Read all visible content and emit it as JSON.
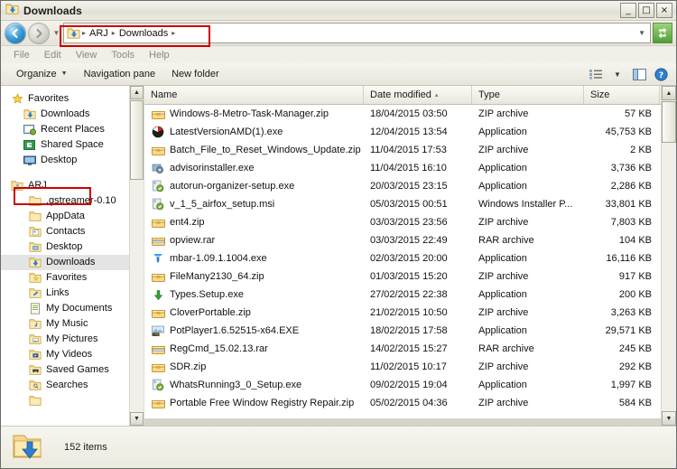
{
  "window": {
    "title": "Downloads",
    "title_icon": "folder-download-icon",
    "controls": {
      "minimize": "_",
      "maximize": "□",
      "close": "×"
    }
  },
  "address_bar": {
    "back_label": "Back",
    "forward_label": "Forward",
    "history_dropdown": "recent-locations-dropdown",
    "folder_icon": "folder-download-icon",
    "crumbs": [
      "ARJ",
      "Downloads"
    ],
    "separator": "▸",
    "dropdown_caret": "▼",
    "refresh_label": "Refresh",
    "highlighted": true
  },
  "menu": {
    "items": [
      "File",
      "Edit",
      "View",
      "Tools",
      "Help"
    ]
  },
  "toolbar": {
    "organize_label": "Organize",
    "organize_caret": "▼",
    "navigation_pane_label": "Navigation pane",
    "new_folder_label": "New folder",
    "view_icon": "list-view-icon",
    "view_caret": "▼",
    "preview_icon": "preview-pane-icon",
    "help_icon": "help-icon"
  },
  "sidebar": {
    "items": [
      {
        "label": "Favorites",
        "icon": "star-icon",
        "level": 0,
        "selected": false
      },
      {
        "label": "Downloads",
        "icon": "folder-download-icon",
        "level": 1,
        "selected": false
      },
      {
        "label": "Recent Places",
        "icon": "recent-places-icon",
        "level": 1,
        "selected": false
      },
      {
        "label": "Shared Space",
        "icon": "shared-folder-icon",
        "level": 1,
        "selected": false
      },
      {
        "label": "Desktop",
        "icon": "desktop-icon",
        "level": 1,
        "selected": false
      },
      {
        "label": "ARJ",
        "icon": "user-folder-icon",
        "level": 0,
        "selected": false,
        "highlighted": true
      },
      {
        "label": ".gstreamer-0.10",
        "icon": "folder-icon",
        "level": 2,
        "selected": false
      },
      {
        "label": "AppData",
        "icon": "folder-icon",
        "level": 2,
        "selected": false
      },
      {
        "label": "Contacts",
        "icon": "contacts-folder-icon",
        "level": 2,
        "selected": false
      },
      {
        "label": "Desktop",
        "icon": "desktop-folder-icon",
        "level": 2,
        "selected": false
      },
      {
        "label": "Downloads",
        "icon": "folder-download-icon",
        "level": 2,
        "selected": true
      },
      {
        "label": "Favorites",
        "icon": "favorites-folder-icon",
        "level": 2,
        "selected": false
      },
      {
        "label": "Links",
        "icon": "links-folder-icon",
        "level": 2,
        "selected": false
      },
      {
        "label": "My Documents",
        "icon": "documents-folder-icon",
        "level": 2,
        "selected": false
      },
      {
        "label": "My Music",
        "icon": "music-folder-icon",
        "level": 2,
        "selected": false
      },
      {
        "label": "My Pictures",
        "icon": "pictures-folder-icon",
        "level": 2,
        "selected": false
      },
      {
        "label": "My Videos",
        "icon": "videos-folder-icon",
        "level": 2,
        "selected": false
      },
      {
        "label": "Saved Games",
        "icon": "saved-games-icon",
        "level": 2,
        "selected": false
      },
      {
        "label": "Searches",
        "icon": "searches-folder-icon",
        "level": 2,
        "selected": false
      }
    ],
    "scroll_up": "▲",
    "scroll_down": "▼"
  },
  "file_list": {
    "columns": [
      {
        "label": "Name",
        "sorted": false
      },
      {
        "label": "Date modified",
        "sorted": true,
        "sort_caret": "▴"
      },
      {
        "label": "Type",
        "sorted": false
      },
      {
        "label": "Size",
        "sorted": false
      }
    ],
    "rows": [
      {
        "name": "Windows-8-Metro-Task-Manager.zip",
        "icon": "zip-archive-icon",
        "date": "18/04/2015 03:50",
        "type": "ZIP archive",
        "size": "57 KB"
      },
      {
        "name": "LatestVersionAMD(1).exe",
        "icon": "amd-app-icon",
        "date": "12/04/2015 13:54",
        "type": "Application",
        "size": "45,753 KB"
      },
      {
        "name": "Batch_File_to_Reset_Windows_Update.zip",
        "icon": "zip-archive-icon",
        "date": "11/04/2015 17:53",
        "type": "ZIP archive",
        "size": "2 KB"
      },
      {
        "name": "advisorinstaller.exe",
        "icon": "gear-app-icon",
        "date": "11/04/2015 16:10",
        "type": "Application",
        "size": "3,736 KB"
      },
      {
        "name": "autorun-organizer-setup.exe",
        "icon": "installer-icon",
        "date": "20/03/2015 23:15",
        "type": "Application",
        "size": "2,286 KB"
      },
      {
        "name": "v_1_5_airfox_setup.msi",
        "icon": "installer-icon",
        "date": "05/03/2015 00:51",
        "type": "Windows Installer P...",
        "size": "33,801 KB"
      },
      {
        "name": "ent4.zip",
        "icon": "zip-archive-icon",
        "date": "03/03/2015 23:56",
        "type": "ZIP archive",
        "size": "7,803 KB"
      },
      {
        "name": "opview.rar",
        "icon": "rar-archive-icon",
        "date": "03/03/2015 22:49",
        "type": "RAR archive",
        "size": "104 KB"
      },
      {
        "name": "mbar-1.09.1.1004.exe",
        "icon": "mbar-app-icon",
        "date": "02/03/2015 20:00",
        "type": "Application",
        "size": "16,116 KB"
      },
      {
        "name": "FileMany2130_64.zip",
        "icon": "zip-archive-icon",
        "date": "01/03/2015 15:20",
        "type": "ZIP archive",
        "size": "917 KB"
      },
      {
        "name": "Types.Setup.exe",
        "icon": "green-download-icon",
        "date": "27/02/2015 22:38",
        "type": "Application",
        "size": "200 KB"
      },
      {
        "name": "CloverPortable.zip",
        "icon": "zip-archive-icon",
        "date": "21/02/2015 10:50",
        "type": "ZIP archive",
        "size": "3,263 KB"
      },
      {
        "name": "PotPlayer1.6.52515-x64.EXE",
        "icon": "potplayer-icon",
        "date": "18/02/2015 17:58",
        "type": "Application",
        "size": "29,571 KB"
      },
      {
        "name": "RegCmd_15.02.13.rar",
        "icon": "rar-archive-icon",
        "date": "14/02/2015 15:27",
        "type": "RAR archive",
        "size": "245 KB"
      },
      {
        "name": "SDR.zip",
        "icon": "zip-archive-icon",
        "date": "11/02/2015 10:17",
        "type": "ZIP archive",
        "size": "292 KB"
      },
      {
        "name": "WhatsRunning3_0_Setup.exe",
        "icon": "installer-icon",
        "date": "09/02/2015 19:04",
        "type": "Application",
        "size": "1,997 KB"
      },
      {
        "name": "Portable Free Window Registry Repair.zip",
        "icon": "zip-archive-icon",
        "date": "05/02/2015 04:36",
        "type": "ZIP archive",
        "size": "584 KB"
      }
    ],
    "scroll_up": "▲",
    "scroll_down": "▼"
  },
  "status_bar": {
    "folder_icon": "folder-download-large-icon",
    "item_count": "152 items"
  },
  "colors": {
    "highlight_border": "#cc0000",
    "selection": "#e4e4e4",
    "chrome": "#f0efe8",
    "refresh_green": "#4f9e36"
  }
}
